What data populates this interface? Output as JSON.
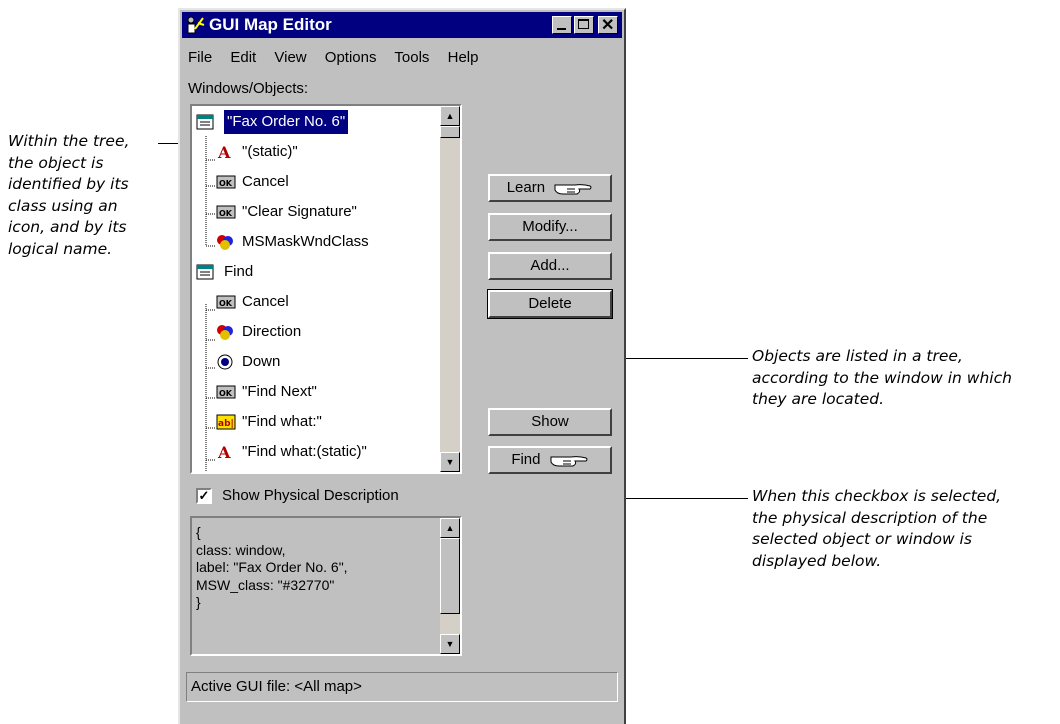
{
  "window": {
    "title": "GUI Map Editor",
    "menu": [
      "File",
      "Edit",
      "View",
      "Options",
      "Tools",
      "Help"
    ],
    "tree_label": "Windows/Objects:",
    "tree_items": [
      {
        "label": "\"Fax Order No. 6\"",
        "icon": "window-icon",
        "selected": true
      },
      {
        "label": "\"(static)\"",
        "icon": "static-text-icon"
      },
      {
        "label": "Cancel",
        "icon": "push-button-icon"
      },
      {
        "label": "\"Clear Signature\"",
        "icon": "push-button-icon"
      },
      {
        "label": "MSMaskWndClass",
        "icon": "object-icon"
      },
      {
        "label": "Find",
        "icon": "window-icon"
      },
      {
        "label": "Cancel",
        "icon": "push-button-icon"
      },
      {
        "label": "Direction",
        "icon": "object-icon"
      },
      {
        "label": "Down",
        "icon": "radio-button-icon"
      },
      {
        "label": "\"Find Next\"",
        "icon": "push-button-icon"
      },
      {
        "label": "\"Find what:\"",
        "icon": "edit-field-icon"
      },
      {
        "label": "\"Find what:(static)\"",
        "icon": "static-text-icon"
      }
    ],
    "buttons": {
      "learn": "Learn",
      "modify": "Modify...",
      "add": "Add...",
      "delete": "Delete",
      "show": "Show",
      "find": "Find"
    },
    "checkbox_label": "Show Physical Description",
    "checkbox_checked": true,
    "physical_description": "{\nclass: window,\nlabel: \"Fax Order No. 6\",\nMSW_class: \"#32770\"\n}",
    "status_text": "Active GUI file: <All map>"
  },
  "annotations": {
    "tree_icon": [
      "Within the tree,",
      "the object is",
      "identified by its",
      "class using an",
      "icon, and by its",
      "logical name."
    ],
    "tree_list": [
      "Objects are listed in a tree,",
      "according to the window in which",
      "they are located."
    ],
    "checkbox": [
      "When this checkbox is selected,",
      "the physical description of the",
      "selected object or window is",
      "displayed below."
    ]
  }
}
